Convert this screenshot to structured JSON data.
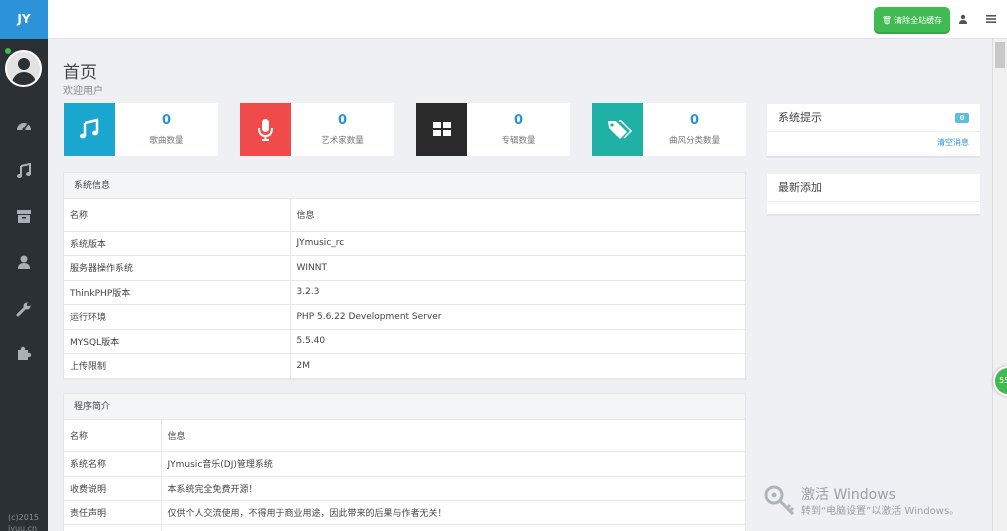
{
  "brand": "JY",
  "topbar": {
    "clear_cache": "清除全站缓存",
    "user_icon": "user-icon",
    "menu_icon": "list-icon"
  },
  "sidebar": {
    "nav": [
      "dashboard-icon",
      "music-icon",
      "archive-icon",
      "user-icon",
      "wrench-icon",
      "puzzle-icon"
    ],
    "footer_line1": "(c)2015",
    "footer_line2": "jyuu.cn"
  },
  "page": {
    "title": "首页",
    "subtitle": "欢迎用户"
  },
  "stats": [
    {
      "value": "0",
      "label": "歌曲数量",
      "icon": "music-note-icon",
      "color": "#1aa7cf"
    },
    {
      "value": "0",
      "label": "艺术家数量",
      "icon": "microphone-icon",
      "color": "#ef4b4b"
    },
    {
      "value": "0",
      "label": "专辑数量",
      "icon": "grid-icon",
      "color": "#2a2a2a"
    },
    {
      "value": "0",
      "label": "曲风分类数量",
      "icon": "tags-icon",
      "color": "#1fb1a6"
    }
  ],
  "sysinfo": {
    "title": "系统信息",
    "header": [
      "名称",
      "信息"
    ],
    "rows": [
      [
        "系统版本",
        "JYmusic_rc"
      ],
      [
        "服务器操作系统",
        "WINNT"
      ],
      [
        "ThinkPHP版本",
        "3.2.3"
      ],
      [
        "运行环境",
        "PHP 5.6.22 Development Server"
      ],
      [
        "MYSQL版本",
        "5.5.40"
      ],
      [
        "上传限制",
        "2M"
      ]
    ]
  },
  "intro": {
    "title": "程序简介",
    "header": [
      "名称",
      "信息"
    ],
    "rows": [
      [
        "系统名称",
        "JYmusic音乐(DJ)管理系统"
      ],
      [
        "收费说明",
        "本系统完全免费开源！"
      ],
      [
        "责任声明",
        "仅供个人交流使用，不得用于商业用途，因此带来的后果与作者无关！"
      ]
    ]
  },
  "notice": {
    "title": "系统提示",
    "badge": "0",
    "clear": "清空消息"
  },
  "latest": {
    "title": "最新添加"
  },
  "float_ball": "55",
  "watermark": {
    "line1": "激活 Windows",
    "line2": "转到“电脑设置”以激活 Windows。"
  }
}
